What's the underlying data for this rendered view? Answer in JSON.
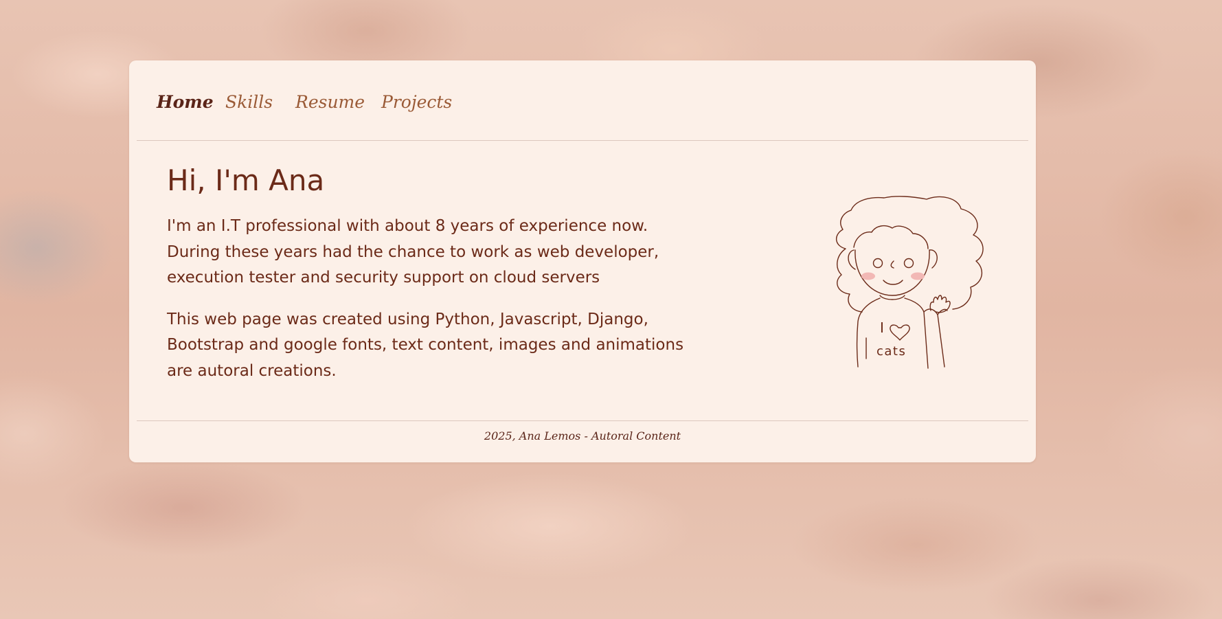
{
  "nav": {
    "items": [
      {
        "label": "Home",
        "active": true
      },
      {
        "label": "Skills",
        "active": false
      },
      {
        "label": "Resume",
        "active": false
      },
      {
        "label": "Projects",
        "active": false
      }
    ]
  },
  "main": {
    "heading": "Hi, I'm Ana",
    "paragraphs": [
      "I'm an I.T professional with about 8 years of experience now. During these years had the chance to work as web developer, execution tester and security support on cloud servers",
      "This web page was created using Python, Javascript, Django, Bootstrap and google fonts, text content, images and animations are autoral creations."
    ],
    "illustration": {
      "shirt_word_1": "I",
      "shirt_word_2": "cats",
      "icon": "heart-icon"
    }
  },
  "footer": {
    "text": "2025, Ana Lemos - Autoral Content"
  },
  "colors": {
    "card_background": "#fcf0e8",
    "text_dark": "#6b2a18",
    "nav_link": "#9a5a36",
    "nav_active": "#5a2418",
    "cheek": "#f2b8b5",
    "line_art": "#6b2a18"
  }
}
